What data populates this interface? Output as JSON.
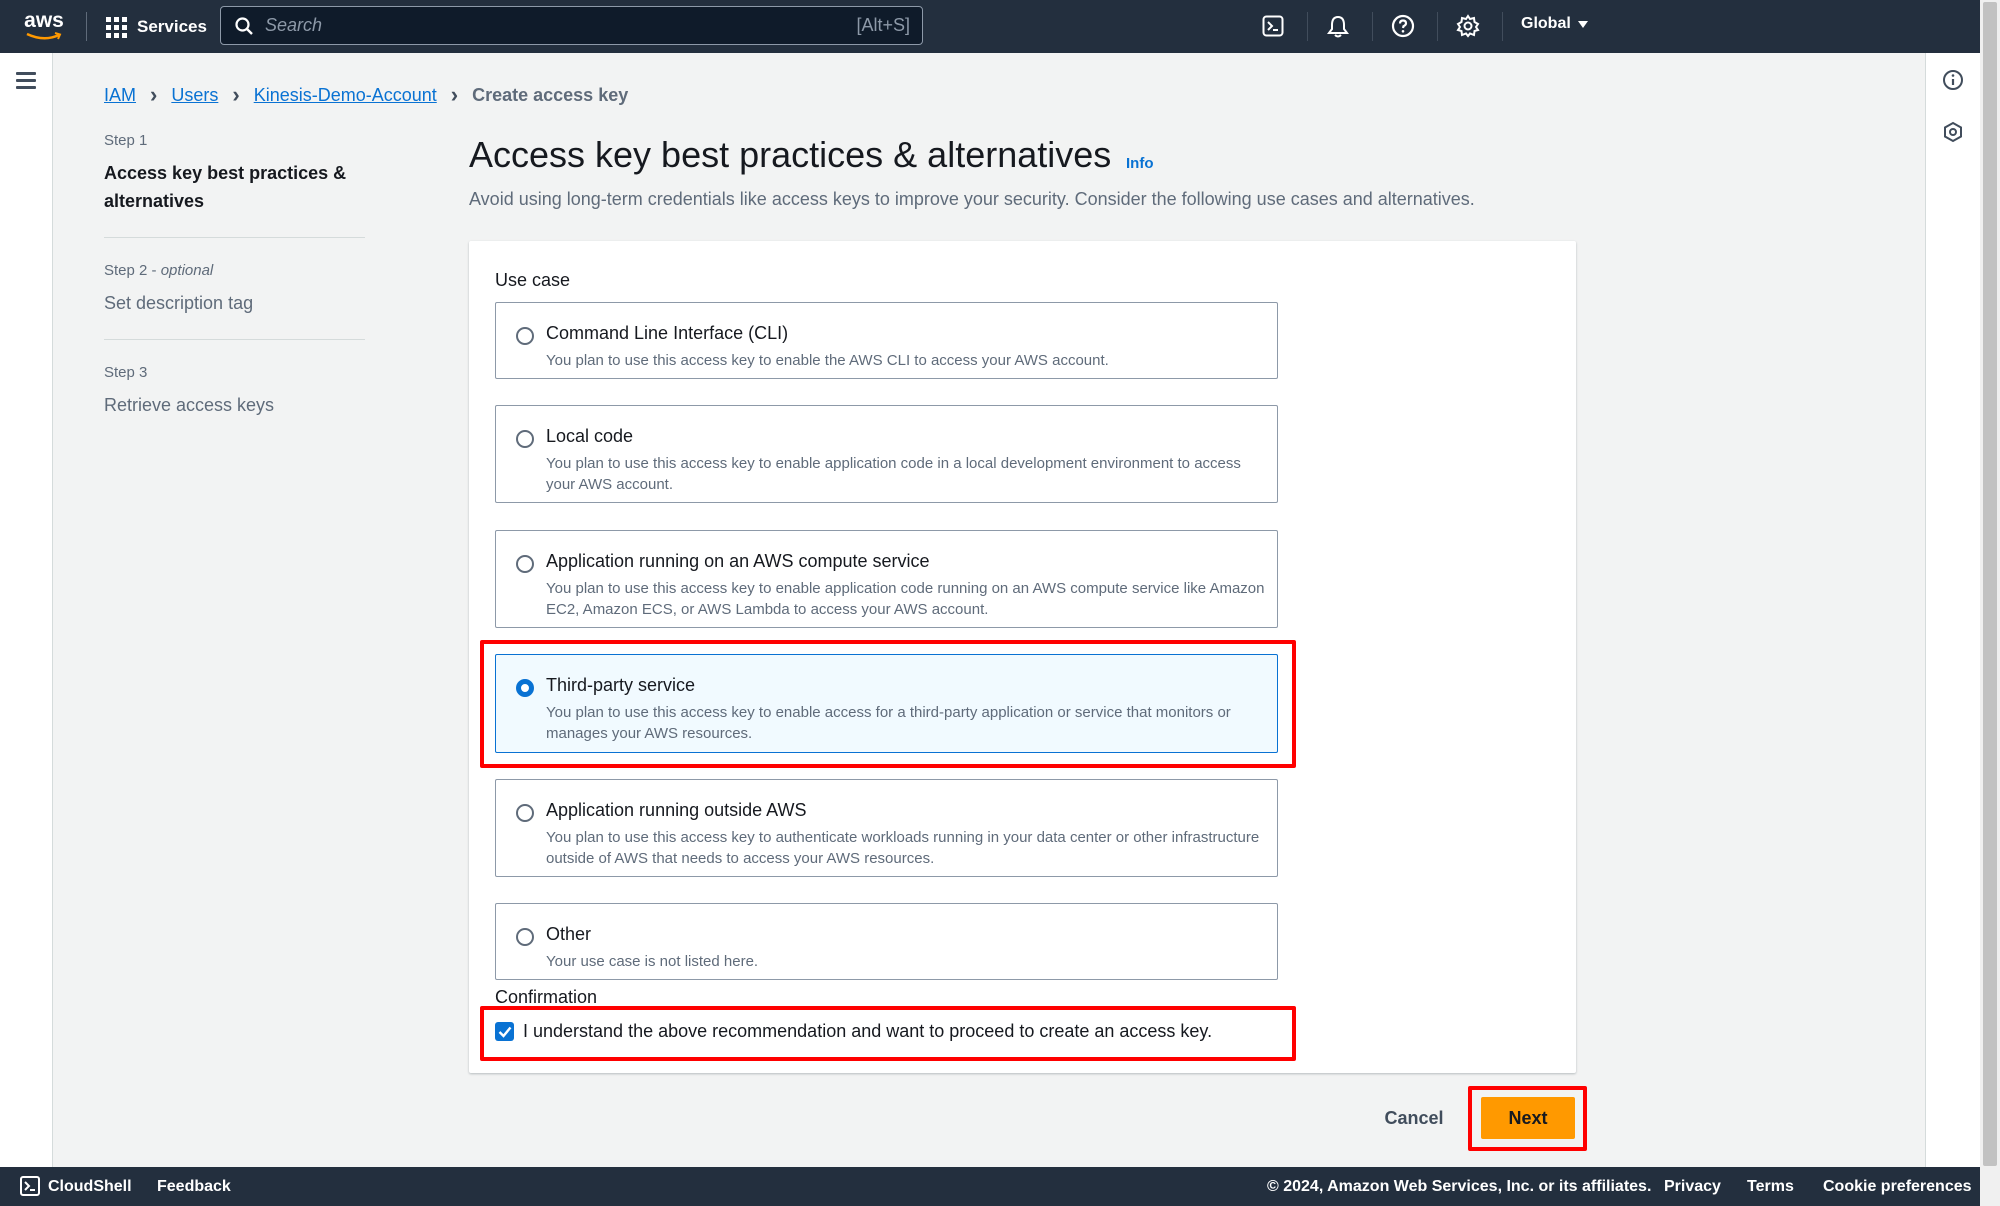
{
  "topnav": {
    "logo_text": "aws",
    "services_label": "Services",
    "search_placeholder": "Search",
    "search_shortcut": "[Alt+S]",
    "region": "Global",
    "icons": [
      "cloudshell-icon",
      "bell-icon",
      "help-icon",
      "settings-icon"
    ]
  },
  "breadcrumb": {
    "items": [
      "IAM",
      "Users",
      "Kinesis-Demo-Account"
    ],
    "current": "Create access key"
  },
  "steps": [
    {
      "label": "Step 1",
      "optional": "",
      "title": "Access key best practices & alternatives"
    },
    {
      "label": "Step 2",
      "optional": "optional",
      "title": "Set description tag"
    },
    {
      "label": "Step 3",
      "optional": "",
      "title": "Retrieve access keys"
    }
  ],
  "header": {
    "title": "Access key best practices & alternatives",
    "info": "Info",
    "description": "Avoid using long-term credentials like access keys to improve your security. Consider the following use cases and alternatives."
  },
  "usecase": {
    "label": "Use case",
    "selected_index": 3,
    "options": [
      {
        "title": "Command Line Interface (CLI)",
        "desc": "You plan to use this access key to enable the AWS CLI to access your AWS account."
      },
      {
        "title": "Local code",
        "desc": "You plan to use this access key to enable application code in a local development environment to access your AWS account."
      },
      {
        "title": "Application running on an AWS compute service",
        "desc": "You plan to use this access key to enable application code running on an AWS compute service like Amazon EC2, Amazon ECS, or AWS Lambda to access your AWS account."
      },
      {
        "title": "Third-party service",
        "desc": "You plan to use this access key to enable access for a third-party application or service that monitors or manages your AWS resources."
      },
      {
        "title": "Application running outside AWS",
        "desc": "You plan to use this access key to authenticate workloads running in your data center or other infrastructure outside of AWS that needs to access your AWS resources."
      },
      {
        "title": "Other",
        "desc": "Your use case is not listed here."
      }
    ]
  },
  "confirmation": {
    "label": "Confirmation",
    "checked": true,
    "text": "I understand the above recommendation and want to proceed to create an access key."
  },
  "actions": {
    "cancel": "Cancel",
    "next": "Next"
  },
  "footer": {
    "cloudshell": "CloudShell",
    "feedback": "Feedback",
    "copyright": "© 2024, Amazon Web Services, Inc. or its affiliates.",
    "privacy": "Privacy",
    "terms": "Terms",
    "cookies": "Cookie preferences"
  },
  "colors": {
    "nav_bg": "#232f3e",
    "link": "#0972d3",
    "primary_button": "#ff9900",
    "highlight": "#ff0000"
  }
}
